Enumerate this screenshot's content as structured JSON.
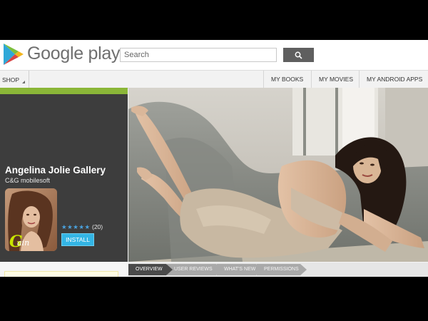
{
  "header": {
    "logo_text": "Google play",
    "search_placeholder": "Search",
    "search_button_icon": "search-icon"
  },
  "nav": {
    "shop_label": "SHOP",
    "items": [
      {
        "label": "MY BOOKS"
      },
      {
        "label": "MY MOVIES"
      },
      {
        "label": "MY ANDROID APPS"
      }
    ]
  },
  "app": {
    "title": "Angelina Jolie Gallery",
    "developer": "C&G mobilesoft",
    "rating_stars": "★★★★★",
    "rating_value": 5,
    "rating_count": "(20)",
    "install_label": "INSTALL"
  },
  "tabs": [
    {
      "label": "OVERVIEW",
      "active": true
    },
    {
      "label": "USER REVIEWS",
      "active": false
    },
    {
      "label": "WHAT'S NEW",
      "active": false
    },
    {
      "label": "PERMISSIONS",
      "active": false
    }
  ],
  "colors": {
    "accent_green": "#8bb638",
    "install_blue": "#33b5e5",
    "panel_bg": "#3d3d3d"
  }
}
